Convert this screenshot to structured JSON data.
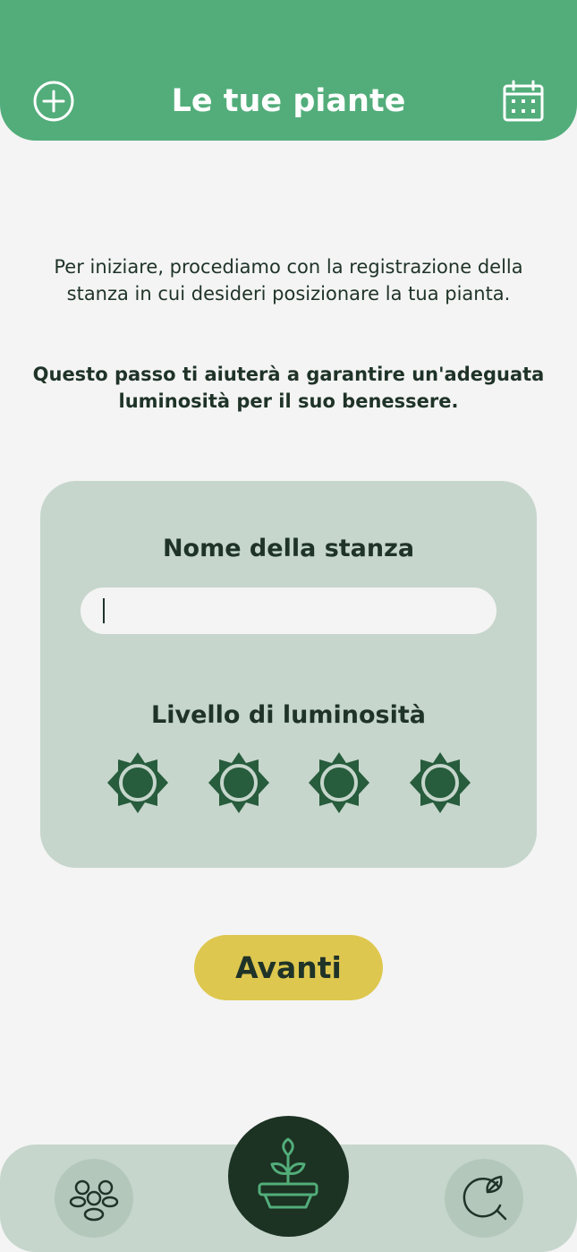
{
  "header": {
    "title": "Le tue piante",
    "add_icon": "plus-circle-icon",
    "calendar_icon": "calendar-icon"
  },
  "intro": {
    "text": "Per iniziare, procediamo con la registrazione della stanza in cui desideri posizionare la tua pianta.",
    "bold_text": "Questo passo ti aiuterà a garantire un'adeguata luminosità per il suo benessere."
  },
  "form": {
    "room_name_label": "Nome della stanza",
    "room_name_value": "",
    "brightness_label": "Livello di luminosità",
    "brightness_levels": 4,
    "sun_icon": "sun-icon"
  },
  "actions": {
    "next_label": "Avanti"
  },
  "nav": {
    "left_icon": "community-icon",
    "center_icon": "plant-pot-icon",
    "right_icon": "leaf-search-icon"
  },
  "colors": {
    "primary_green": "#52ad7a",
    "dark_green": "#1c3223",
    "sun_green": "#275c3c",
    "card_bg": "#c6d6cc",
    "button_yellow": "#dec74f",
    "background": "#f4f4f4"
  }
}
